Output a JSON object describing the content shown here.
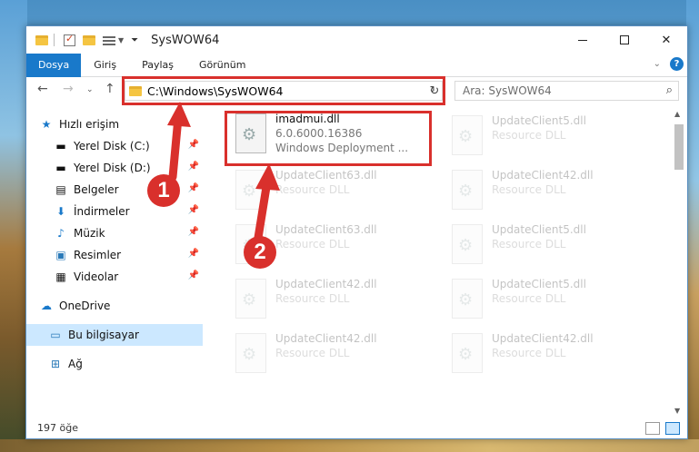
{
  "window": {
    "title": "SysWOW64"
  },
  "ribbon": {
    "tabs": [
      {
        "label": "Dosya"
      },
      {
        "label": "Giriş"
      },
      {
        "label": "Paylaş"
      },
      {
        "label": "Görünüm"
      }
    ]
  },
  "nav": {
    "address": "C:\\Windows\\SysWOW64",
    "search_placeholder": "Ara: SysWOW64"
  },
  "sidebar": {
    "items": [
      {
        "label": "Hızlı erişim",
        "icon": "star-icon"
      },
      {
        "label": "Yerel Disk (C:)",
        "icon": "drive-icon"
      },
      {
        "label": "Yerel Disk (D:)",
        "icon": "drive-icon"
      },
      {
        "label": "Belgeler",
        "icon": "documents-icon"
      },
      {
        "label": "İndirmeler",
        "icon": "download-icon"
      },
      {
        "label": "Müzik",
        "icon": "music-icon"
      },
      {
        "label": "Resimler",
        "icon": "pictures-icon"
      },
      {
        "label": "Videolar",
        "icon": "videos-icon"
      },
      {
        "label": "OneDrive",
        "icon": "cloud-icon"
      },
      {
        "label": "Bu bilgisayar",
        "icon": "computer-icon"
      },
      {
        "label": "Ağ",
        "icon": "network-icon"
      }
    ]
  },
  "files": [
    {
      "name": "imadmui.dll",
      "line2": "6.0.6000.16386",
      "line3": "Windows Deployment ..."
    },
    {
      "name": "UpdateClient5.dll",
      "line2": "Resource DLL"
    },
    {
      "name": "UpdateClient63.dll",
      "line2": "Resource DLL"
    },
    {
      "name": "UpdateClient42.dll",
      "line2": "Resource DLL"
    },
    {
      "name": "UpdateClient63.dll",
      "line2": "Resource DLL"
    },
    {
      "name": "UpdateClient5.dll",
      "line2": "Resource DLL"
    },
    {
      "name": "UpdateClient42.dll",
      "line2": "Resource DLL"
    },
    {
      "name": "UpdateClient5.dll",
      "line2": "Resource DLL"
    },
    {
      "name": "UpdateClient42.dll",
      "line2": "Resource DLL"
    },
    {
      "name": "UpdateClient42.dll",
      "line2": "Resource DLL"
    }
  ],
  "status": {
    "count": "197 öğe"
  },
  "callouts": {
    "one": "1",
    "two": "2"
  },
  "colors": {
    "accent": "#1979ca",
    "highlight": "#d9302c",
    "selected": "#cce8ff"
  }
}
